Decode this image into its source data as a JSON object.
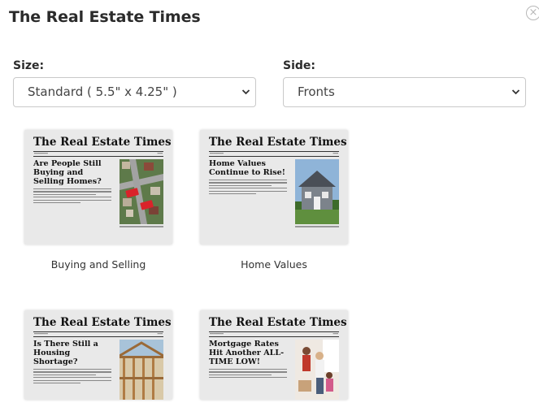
{
  "modal": {
    "title": "The Real Estate Times",
    "close_glyph": "×"
  },
  "size": {
    "label": "Size:",
    "value": "Standard ( 5.5\" x 4.25\" )"
  },
  "side": {
    "label": "Side:",
    "value": "Fronts"
  },
  "chevron": "⌄",
  "templates": [
    {
      "masthead": "The Real Estate Times",
      "headline": "Are People Still Buying and Selling Homes?",
      "label": "Buying and Selling"
    },
    {
      "masthead": "The Real Estate Times",
      "headline": "Home Values Continue to Rise!",
      "label": "Home Values"
    },
    {
      "masthead": "The Real Estate Times",
      "headline": "Is There Still a Housing Shortage?",
      "label": ""
    },
    {
      "masthead": "The Real Estate Times",
      "headline": "Mortgage Rates Hit Another ALL-TIME LOW!",
      "label": ""
    }
  ],
  "colors": {
    "title": "#2b2b2b",
    "border": "#c9c9c9",
    "thumb_bg": "#e9e9e9"
  }
}
